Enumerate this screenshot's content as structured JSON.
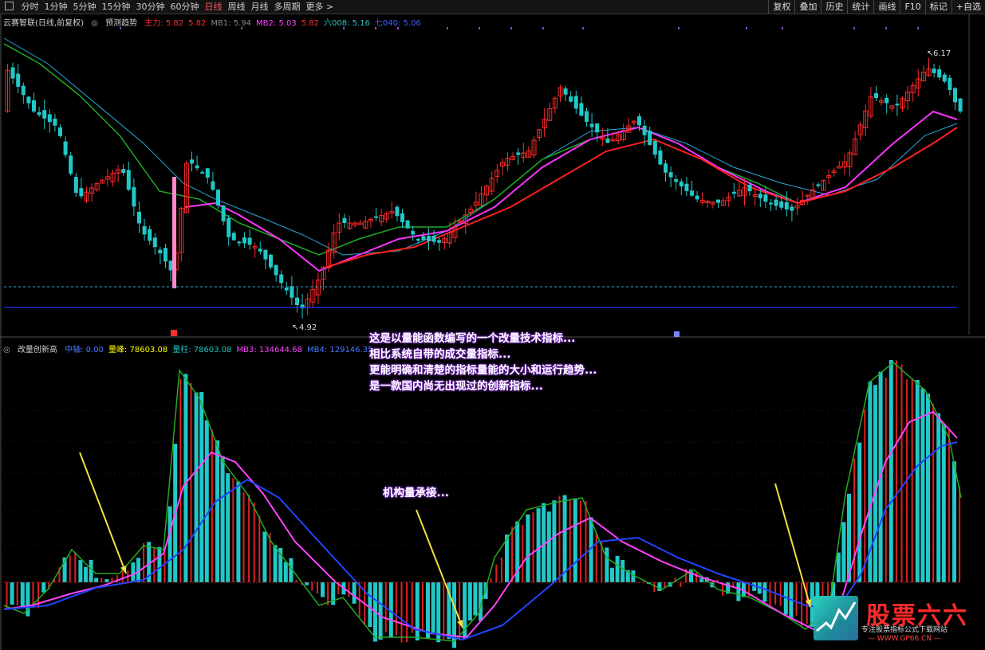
{
  "topbar": {
    "periods": [
      "分时",
      "1分钟",
      "5分钟",
      "15分钟",
      "30分钟",
      "60分钟",
      "日线",
      "周线",
      "月线",
      "多周期",
      "更多 >"
    ],
    "active_period": "日线",
    "right_buttons": [
      "复权",
      "叠加",
      "历史",
      "统计",
      "画线",
      "F10",
      "标记",
      "+自选"
    ]
  },
  "main_legend": {
    "title": "云赛智联(日线,前复权)",
    "subtitle": "预测趋势",
    "items": [
      {
        "label": "主力: 5.82",
        "color": "#ff3030"
      },
      {
        "label": "5.82",
        "color": "#ff3030"
      },
      {
        "label": "MB1: 5.94",
        "color": "#8a8a8a"
      },
      {
        "label": "MB2: 5.03",
        "color": "#ff44ff"
      },
      {
        "label": "5.82",
        "color": "#ff3030"
      },
      {
        "label": "六008: 5.16",
        "color": "#30c0c0"
      },
      {
        "label": "七040: 5.06",
        "color": "#4060ff"
      }
    ]
  },
  "price_labels": {
    "high": "6.17",
    "low": "4.92"
  },
  "ind_legend": {
    "title": "改量创新高",
    "items": [
      {
        "label": "中轴: 0.00",
        "color": "#4a7cff"
      },
      {
        "label": "量峰: 78603.08",
        "color": "#ffff00"
      },
      {
        "label": "量柱: 78603.08",
        "color": "#22c0c0"
      },
      {
        "label": "MB3: 134644.68",
        "color": "#ff44ff"
      },
      {
        "label": "MB4: 129146.35",
        "color": "#4a7cff"
      }
    ]
  },
  "annotations": {
    "lines": [
      "这是以量能函数编写的一个改量技术指标...",
      "相比系统自带的成交量指标...",
      "更能明确和清楚的指标量能的大小和运行趋势...",
      "是一款国内尚无出现过的创新指标..."
    ],
    "institutional": "机构量承接..."
  },
  "watermark": {
    "name": "股票六六",
    "slogan": "专注股票指标公式下载网站",
    "url": "— WWW.GP66.CN —"
  },
  "colors": {
    "up": "#ff2a2a",
    "down": "#22c8c8",
    "ma_slow": "#2aa8d8",
    "ma_green": "#1faa2a",
    "ma_magenta": "#ff33ff",
    "ma_red": "#ff2020",
    "mb3": "#ff44ff",
    "mb4": "#2244ff",
    "arrow": "#f0e040"
  }
}
